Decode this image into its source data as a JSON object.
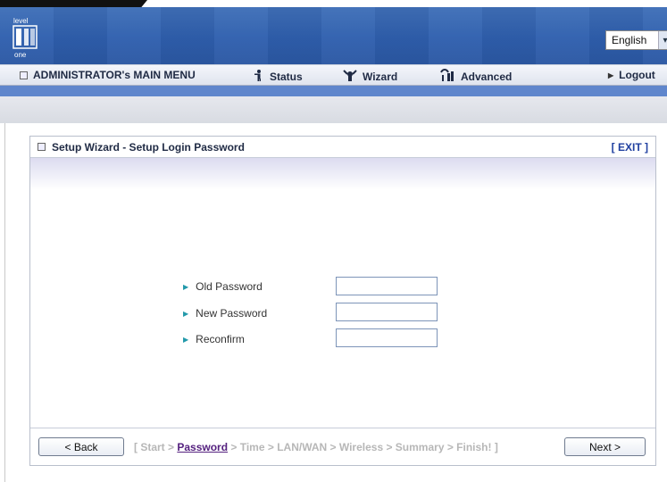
{
  "header": {
    "logo_text": "level one",
    "language": "English"
  },
  "menu": {
    "admin": "ADMINISTRATOR's MAIN MENU",
    "status": "Status",
    "wizard": "Wizard",
    "advanced": "Advanced",
    "logout": "Logout"
  },
  "panel": {
    "title": "Setup Wizard - Setup Login Password",
    "exit": "[ EXIT ]"
  },
  "form": {
    "old_password_label": "Old Password",
    "new_password_label": "New Password",
    "reconfirm_label": "Reconfirm",
    "old_password_value": "",
    "new_password_value": "",
    "reconfirm_value": ""
  },
  "wizard_nav": {
    "back_label": "< Back",
    "next_label": "Next >",
    "steps_prefix": "[ Start > ",
    "current_step": "Password",
    "steps_suffix": " > Time > LAN/WAN > Wireless > Summary > Finish! ]"
  },
  "colors": {
    "header_blue": "#2f5fae",
    "current_step": "#55217f",
    "muted_steps": "#b7b7b7"
  },
  "icons": {
    "status": "person-icon",
    "wizard": "wizard-icon",
    "advanced": "advanced-icon"
  }
}
